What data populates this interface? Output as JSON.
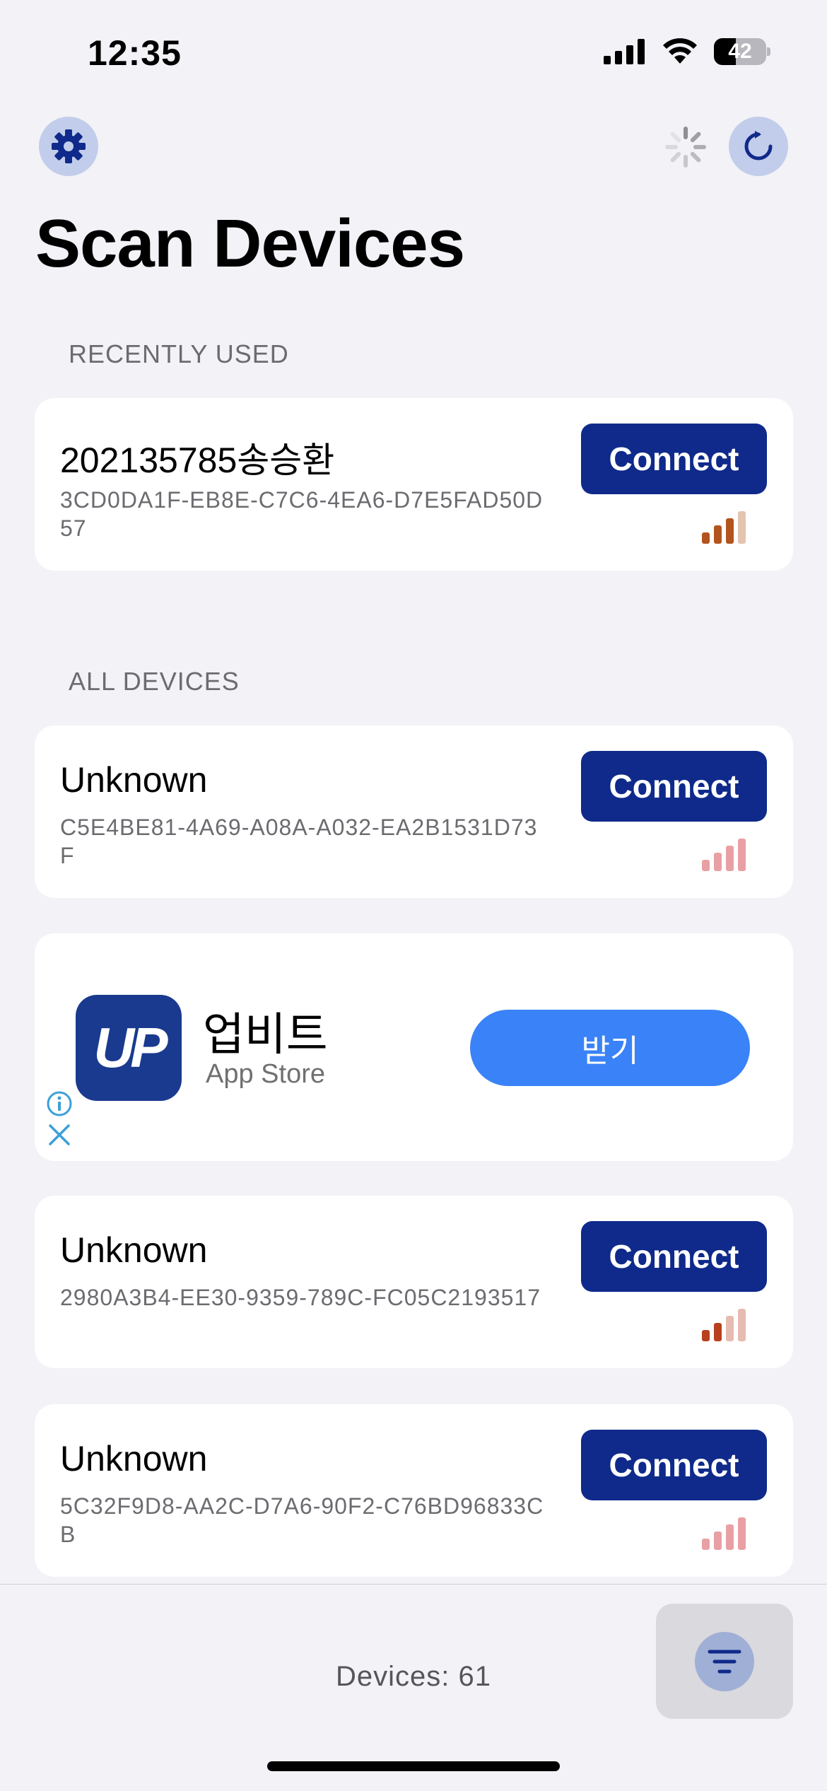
{
  "status_bar": {
    "time": "12:35",
    "battery_level": "42",
    "battery_fraction": 0.42
  },
  "nav": {
    "settings_icon": "gear-icon",
    "refresh_icon": "refresh-icon",
    "activity_icon": "spinner-icon",
    "accent_color": "#0f2a8a",
    "button_bg": "#c2cdeb"
  },
  "title": "Scan Devices",
  "sections": {
    "recent_header": "RECENTLY USED",
    "all_header": "ALL DEVICES"
  },
  "recent_device": {
    "name": "202135785송승환",
    "id": "3CD0DA1F-EB8E-C7C6-4EA6-D7E5FAD50D57",
    "connect_label": "Connect",
    "signal_bars": 3,
    "signal_color": "#b3541e"
  },
  "devices": [
    {
      "name": "Unknown",
      "id": "C5E4BE81-4A69-A08A-A032-EA2B1531D73F",
      "connect_label": "Connect",
      "signal_bars": 0,
      "signal_color": "#e8a0a4"
    },
    {
      "name": "Unknown",
      "id": "2980A3B4-EE30-9359-789C-FC05C2193517",
      "connect_label": "Connect",
      "signal_bars": 2,
      "signal_color": "#b8401e"
    },
    {
      "name": "Unknown",
      "id": "5C32F9D8-AA2C-D7A6-90F2-C76BD96833CB",
      "connect_label": "Connect",
      "signal_bars": 0,
      "signal_color": "#e8a0a4"
    }
  ],
  "ad": {
    "app_icon_text": "UP",
    "app_name": "업비트",
    "store": "App Store",
    "get_label": "받기",
    "info_icon": "info-icon",
    "close_icon": "close-icon",
    "button_color": "#3a82f7"
  },
  "footer": {
    "device_count": "Devices: 61",
    "filter_icon": "filter-icon"
  }
}
